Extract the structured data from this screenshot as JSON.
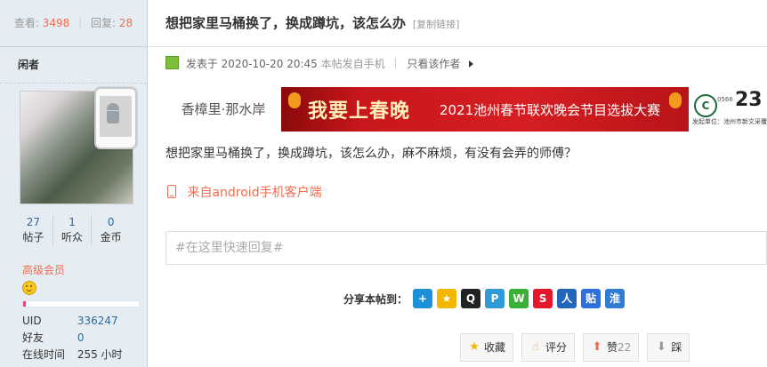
{
  "thread": {
    "views_label": "查看:",
    "views": "3498",
    "sep": "|",
    "replies_label": "回复:",
    "replies": "28",
    "title": "想把家里马桶换了，换成蹲坑，该怎么办",
    "copy_link": "[复制链接]"
  },
  "author": {
    "name": "闲者",
    "counts": [
      {
        "value": "27",
        "label": "帖子"
      },
      {
        "value": "1",
        "label": "听众"
      },
      {
        "value": "0",
        "label": "金币"
      }
    ],
    "rank": "高级会员",
    "progress_fraction": 0.02,
    "progress_color": "#e8467c",
    "info": [
      {
        "key": "UID",
        "value": "336247"
      },
      {
        "key": "好友",
        "value": "0"
      },
      {
        "key": "在线时间",
        "value": "255 小时"
      }
    ]
  },
  "post": {
    "meta_label": "发表于",
    "date": "2020-10-20 20:45",
    "mobile_note": "本帖发自手机",
    "author_only": "只看该作者",
    "body": "想把家里马桶换了，换成蹲坑，该怎么办，麻不麻烦，有没有会弄的师傅？",
    "from_client": "来自android手机客户端"
  },
  "banner": {
    "left_text": "香樟里·那水岸",
    "slogan": "我要上春晚",
    "program": "2021池州春节联欢晚会节目选拔大赛",
    "right_logo": "C",
    "right_small": "0566",
    "right_number": "23",
    "right_bottom": "发起单位：池州市新文采覆盖传"
  },
  "reply_box": {
    "placeholder": "#在这里快速回复#"
  },
  "share": {
    "label": "分享本帖到：",
    "icons": [
      {
        "name": "plus-share-icon",
        "glyph": "+",
        "color": "#1e90d8"
      },
      {
        "name": "qzone-star-icon",
        "glyph": "★",
        "color": "#f2b800"
      },
      {
        "name": "qq-penguin-icon",
        "glyph": "Q",
        "color": "#222222"
      },
      {
        "name": "tencent-weibo-icon",
        "glyph": "P",
        "color": "#2f9bd6"
      },
      {
        "name": "wechat-icon",
        "glyph": "W",
        "color": "#3cb034"
      },
      {
        "name": "sina-weibo-icon",
        "glyph": "S",
        "color": "#e6162d"
      },
      {
        "name": "renren-icon",
        "glyph": "人",
        "color": "#2266bb"
      },
      {
        "name": "tieba-icon",
        "glyph": "贴",
        "color": "#2f6fdd"
      },
      {
        "name": "kaixin-icon",
        "glyph": "淮",
        "color": "#2f7bd6"
      }
    ]
  },
  "actions": {
    "favorite": "收藏",
    "rate": "评分",
    "like": "赞",
    "like_count": "22",
    "dislike": "踩"
  }
}
